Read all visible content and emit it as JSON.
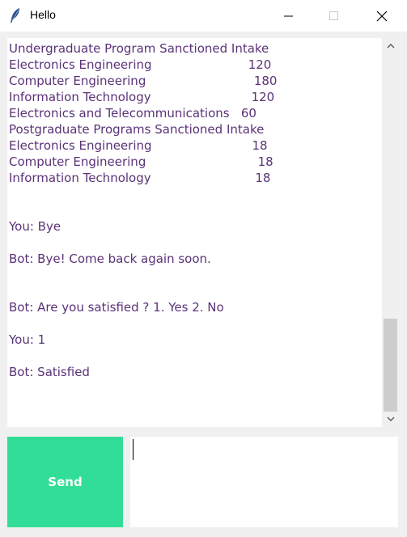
{
  "window": {
    "title": "Hello",
    "minimize_glyph": "—",
    "icon": "feather-icon"
  },
  "chat": {
    "lines": [
      "Undergraduate Program Sanctioned Intake",
      "Electronics Engineering                         120",
      "Computer Engineering                            180",
      "Information Technology                          120",
      "Electronics and Telecommunications   60",
      "Postgraduate Programs Sanctioned Intake",
      "Electronics Engineering                          18",
      "Computer Engineering                             18",
      "Information Technology                           18",
      "",
      "",
      "You: Bye",
      "",
      "Bot: Bye! Come back again soon.",
      "",
      "",
      "Bot: Are you satisfied ? 1. Yes 2. No",
      "",
      "You: 1",
      "",
      "Bot: Satisfied"
    ],
    "text_color": "#5b3277"
  },
  "input": {
    "send_label": "Send",
    "value": "",
    "send_color": "#32de97"
  }
}
